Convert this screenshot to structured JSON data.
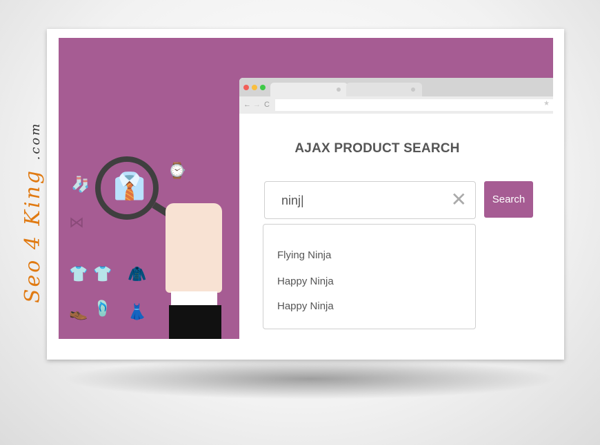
{
  "watermark": {
    "brand": "Seo 4 King",
    "suffix": ".com"
  },
  "colors": {
    "accent": "#a65c93"
  },
  "page": {
    "title": "AJAX PRODUCT SEARCH",
    "search_value": "ninj|",
    "search_button": "Search",
    "suggestions": [
      "Flying Ninja",
      "Happy Ninja",
      "Happy Ninja"
    ]
  },
  "browser": {
    "nav_icons": [
      "back-icon",
      "forward-icon",
      "reload-icon"
    ],
    "star_icon": "★"
  }
}
